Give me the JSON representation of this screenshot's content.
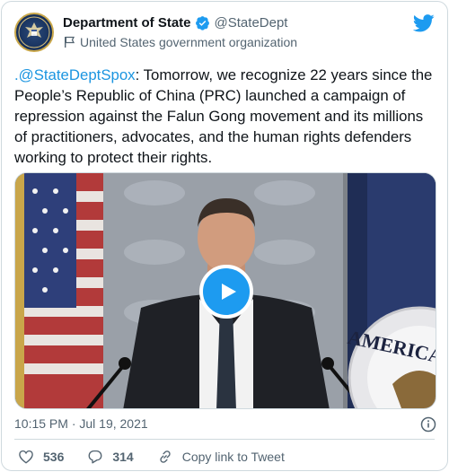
{
  "account": {
    "display_name": "Department of State",
    "handle": "@StateDept",
    "label": "United States government organization",
    "verified": true
  },
  "tweet": {
    "mention": ".@StateDeptSpox",
    "body": ": Tomorrow, we recognize 22 years since the People’s Republic of China (PRC) launched a campaign of repression against the Falun Gong movement and its millions of practitioners, advocates, and the human rights defenders working to protect their rights.",
    "timestamp": "10:15 PM · Jul 19, 2021"
  },
  "media": {
    "type": "video",
    "podium_text": "AMERICA"
  },
  "actions": {
    "likes": "536",
    "replies": "314",
    "copy_label": "Copy link to Tweet"
  },
  "colors": {
    "accent": "#1d9bf0",
    "mention": "#1b95e0",
    "muted_text": "#536471",
    "like_icon": "#536471"
  },
  "icons": [
    "verified-badge-icon",
    "government-flag-icon",
    "twitter-bird-icon",
    "play-icon",
    "info-icon",
    "heart-icon",
    "reply-icon",
    "link-icon"
  ]
}
